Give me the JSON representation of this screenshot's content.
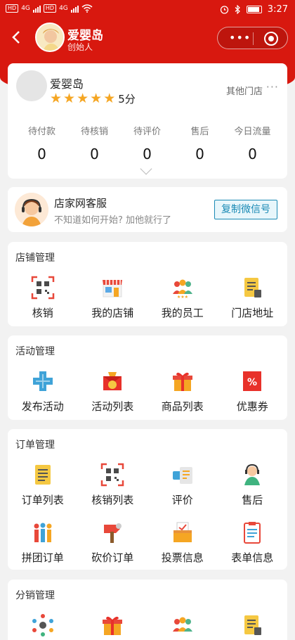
{
  "status_bar": {
    "network_left": "4G",
    "network_right": "4G",
    "time": "3:27"
  },
  "header": {
    "name": "爱婴岛",
    "role": "创始人"
  },
  "store": {
    "name": "爱婴岛",
    "score": "5分",
    "stars": 5,
    "other_store": "其他门店",
    "more": "···",
    "stats": [
      {
        "label": "待付款",
        "value": "0"
      },
      {
        "label": "待核销",
        "value": "0"
      },
      {
        "label": "待评价",
        "value": "0"
      },
      {
        "label": "售后",
        "value": "0"
      },
      {
        "label": "今日流量",
        "value": "0"
      }
    ]
  },
  "service": {
    "title": "店家网客服",
    "subtitle": "不知道如何开始? 加他就行了",
    "button": "复制微信号"
  },
  "sections": [
    {
      "title": "店铺管理",
      "items": [
        {
          "label": "核销",
          "icon": "qr-scan-icon"
        },
        {
          "label": "我的店铺",
          "icon": "storefront-icon"
        },
        {
          "label": "我的员工",
          "icon": "staff-group-icon"
        },
        {
          "label": "门店地址",
          "icon": "address-doc-icon"
        }
      ]
    },
    {
      "title": "活动管理",
      "items": [
        {
          "label": "发布活动",
          "icon": "plus-cross-icon"
        },
        {
          "label": "活动列表",
          "icon": "money-bag-icon"
        },
        {
          "label": "商品列表",
          "icon": "gift-box-icon"
        },
        {
          "label": "优惠券",
          "icon": "percent-coupon-icon"
        }
      ]
    },
    {
      "title": "订单管理",
      "items": [
        {
          "label": "订单列表",
          "icon": "order-list-icon"
        },
        {
          "label": "核销列表",
          "icon": "qr-scan-icon"
        },
        {
          "label": "评价",
          "icon": "review-icon"
        },
        {
          "label": "售后",
          "icon": "support-agent-icon"
        },
        {
          "label": "拼团订单",
          "icon": "group-buy-icon"
        },
        {
          "label": "砍价订单",
          "icon": "bargain-axe-icon"
        },
        {
          "label": "投票信息",
          "icon": "vote-box-icon"
        },
        {
          "label": "表单信息",
          "icon": "clipboard-form-icon"
        }
      ]
    },
    {
      "title": "分销管理",
      "items": [
        {
          "label": "",
          "icon": "network-icon"
        },
        {
          "label": "",
          "icon": "gift-box-icon"
        },
        {
          "label": "",
          "icon": "staff-group-icon"
        },
        {
          "label": "",
          "icon": "address-doc-icon"
        }
      ]
    }
  ],
  "colors": {
    "brand_red": "#d8180f",
    "star": "#f5a623",
    "copy_button": "#1a8ab5"
  }
}
